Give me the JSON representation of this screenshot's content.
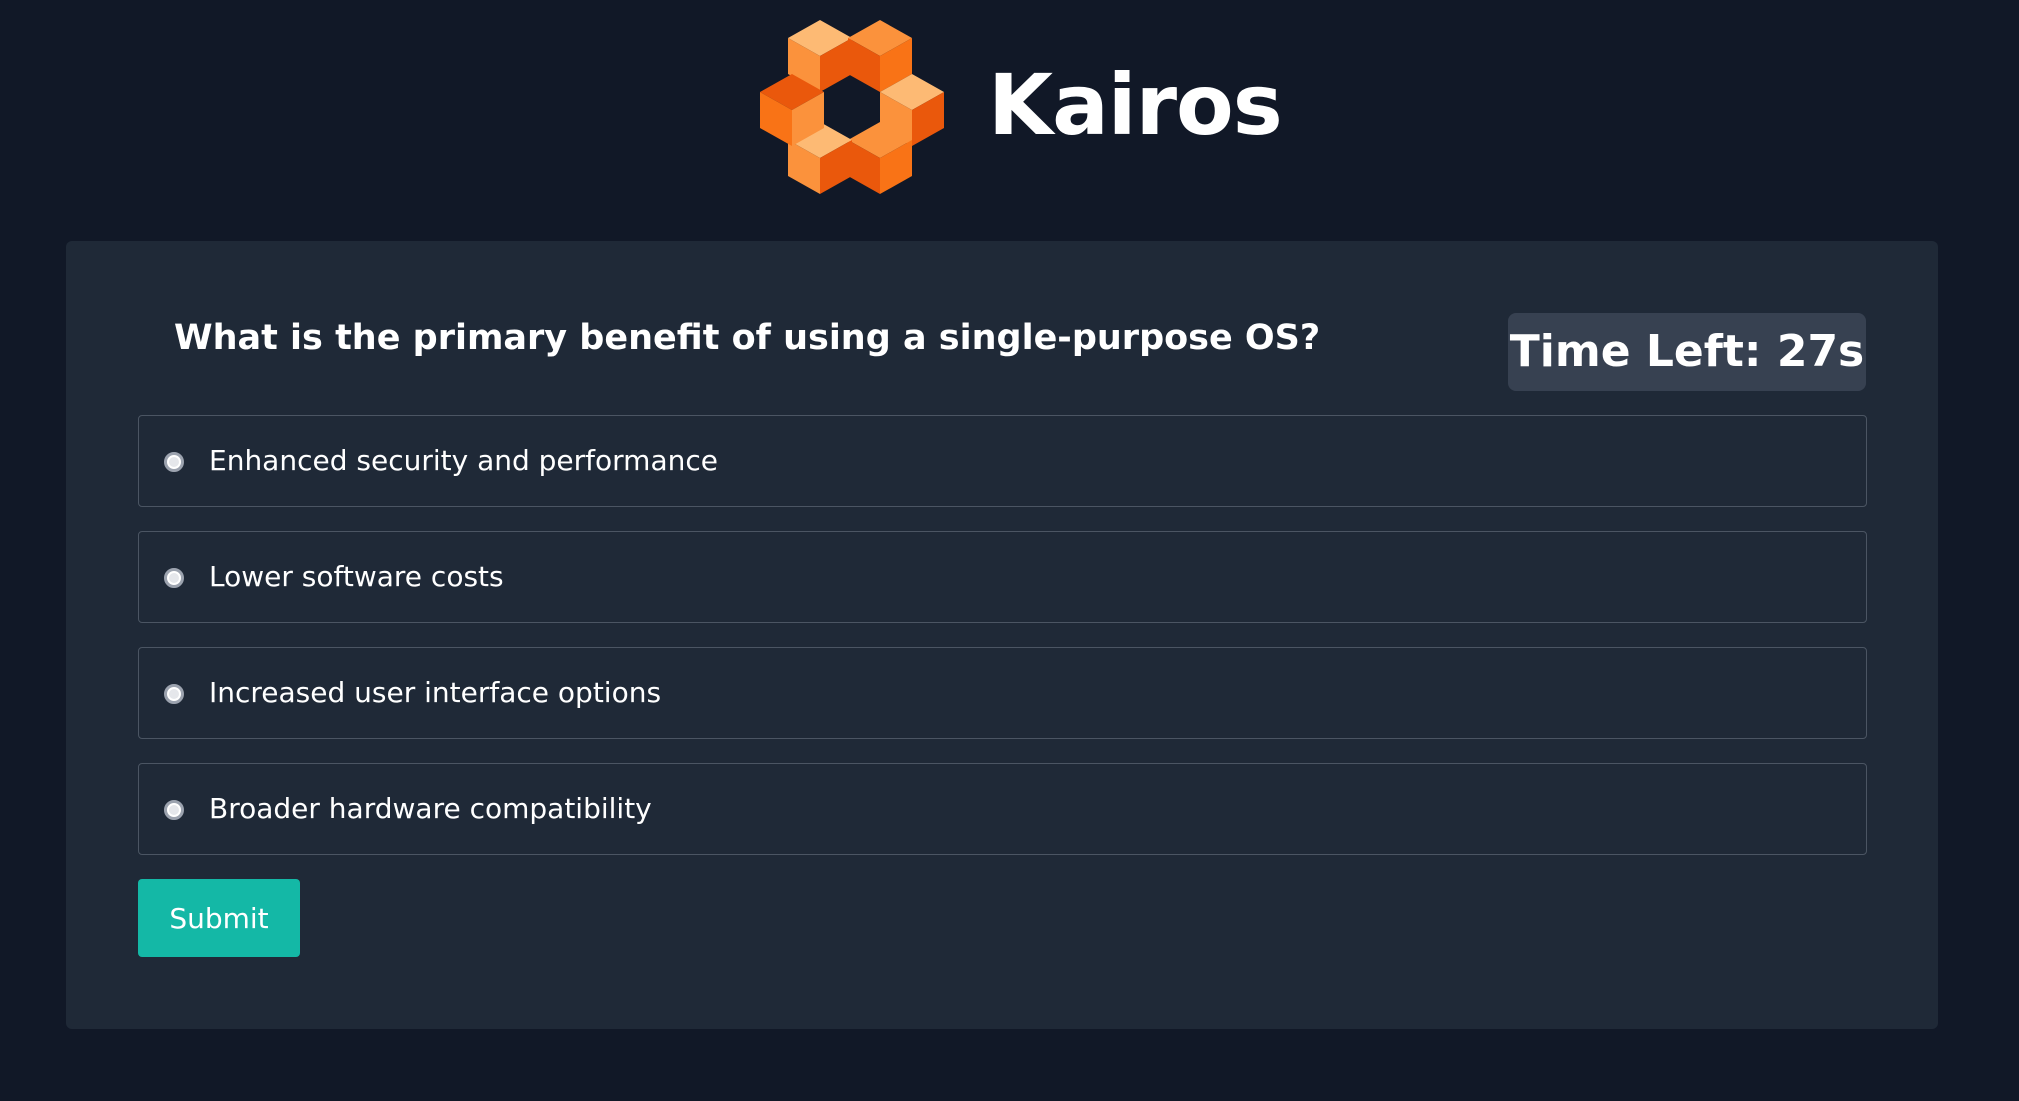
{
  "brand": {
    "name": "Kairos",
    "logo_icon": "hexagonal-cube-logo-icon",
    "accent_color": "#f97316"
  },
  "quiz": {
    "question": "What is the primary benefit of using a single-purpose OS?",
    "timer_text": "Time Left: 27s",
    "options": [
      {
        "label": "Enhanced security and performance",
        "selected": false
      },
      {
        "label": "Lower software costs",
        "selected": false
      },
      {
        "label": "Increased user interface options",
        "selected": false
      },
      {
        "label": "Broader hardware compatibility",
        "selected": false
      }
    ],
    "submit_label": "Submit",
    "submit_color": "#14b8a6"
  },
  "theme": {
    "page_background": "#111827",
    "card_background": "#1f2937",
    "timer_background": "#374151"
  }
}
